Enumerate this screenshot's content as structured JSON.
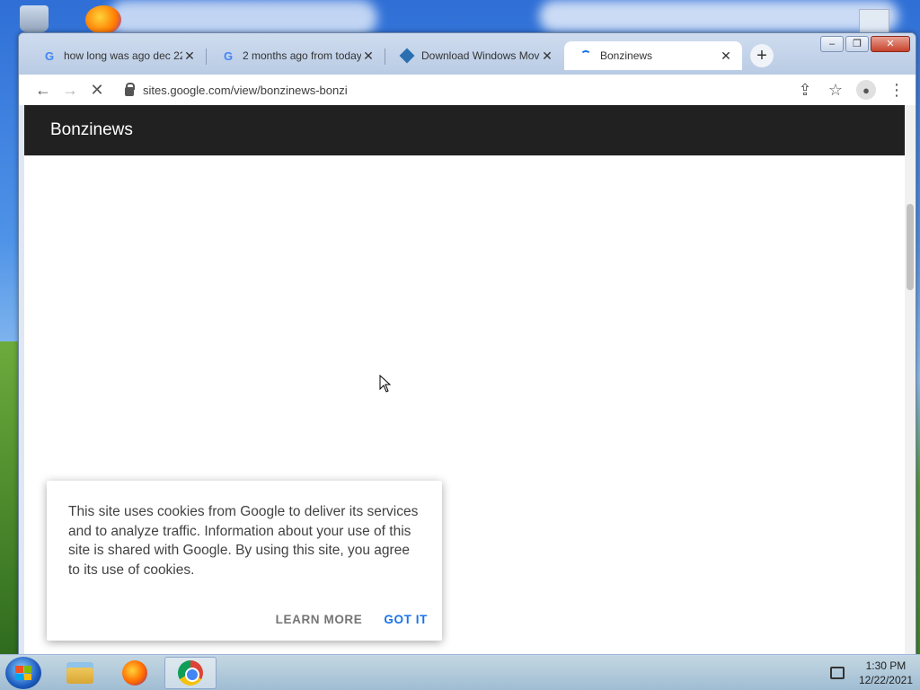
{
  "browser": {
    "tabs": [
      {
        "title": "how long was ago dec 22",
        "icon": "google-icon",
        "close": "✕"
      },
      {
        "title": "2 months ago from today",
        "icon": "google-icon",
        "close": "✕"
      },
      {
        "title": "Download Windows Mov",
        "icon": "diamond-icon",
        "close": "✕"
      },
      {
        "title": "Bonzinews",
        "icon": "loading-spinner-icon",
        "close": "✕",
        "active": true
      }
    ],
    "new_tab_label": "+",
    "url": "sites.google.com/view/bonzinews-bonzi",
    "window_controls": {
      "minimize": "–",
      "maximize": "❐",
      "close": "✕"
    }
  },
  "site": {
    "title": "Bonzinews"
  },
  "cookie_banner": {
    "message": "This site uses cookies from Google to deliver its services and to analyze traffic. Information about your use of this site is shared with Google. By using this site, you agree to its use of cookies.",
    "learn_more": "LEARN MORE",
    "got_it": "GOT IT"
  },
  "taskbar": {
    "time": "1:30 PM",
    "date": "12/22/2021"
  },
  "colors": {
    "site_header": "#212121",
    "accent": "#1a73e8"
  }
}
